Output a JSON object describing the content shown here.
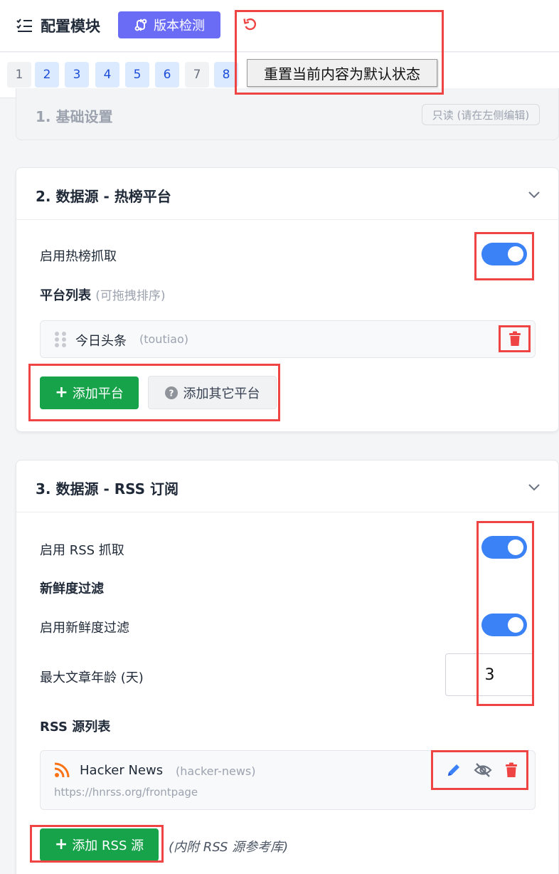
{
  "header": {
    "title": "配置模块",
    "version_button": "版本检测",
    "reset_tooltip": "重置当前内容为默认状态"
  },
  "pager": {
    "pages": [
      "1",
      "2",
      "3",
      "4",
      "5",
      "6",
      "7",
      "8"
    ]
  },
  "section1": {
    "title": "1. 基础设置",
    "readonly_tag": "只读 (请在左侧编辑)"
  },
  "section2": {
    "title": "2. 数据源 - 热榜平台",
    "enable_label": "启用热榜抓取",
    "enable_on": true,
    "list_label": "平台列表",
    "list_hint": "(可拖拽排序)",
    "platforms": [
      {
        "name": "今日头条",
        "id": "(toutiao)"
      }
    ],
    "add_button": "添加平台",
    "add_other_button": "添加其它平台"
  },
  "section3": {
    "title": "3. 数据源 - RSS 订阅",
    "enable_label": "启用 RSS 抓取",
    "enable_on": true,
    "freshness_label": "新鲜度过滤",
    "freshness_enable_label": "启用新鲜度过滤",
    "freshness_enable_on": true,
    "max_age_label": "最大文章年龄 (天)",
    "max_age_value": "3",
    "list_label": "RSS 源列表",
    "feeds": [
      {
        "name": "Hacker News",
        "id": "(hacker-news)",
        "url": "https://hnrss.org/frontpage"
      }
    ],
    "add_button": "添加 RSS 源",
    "add_hint": "(内附 RSS 源参考库)"
  },
  "colors": {
    "accent_blue": "#3b82f6",
    "purple": "#6b6cf6",
    "green": "#16a34a",
    "danger": "#ef4444",
    "rss_orange": "#f97316"
  }
}
